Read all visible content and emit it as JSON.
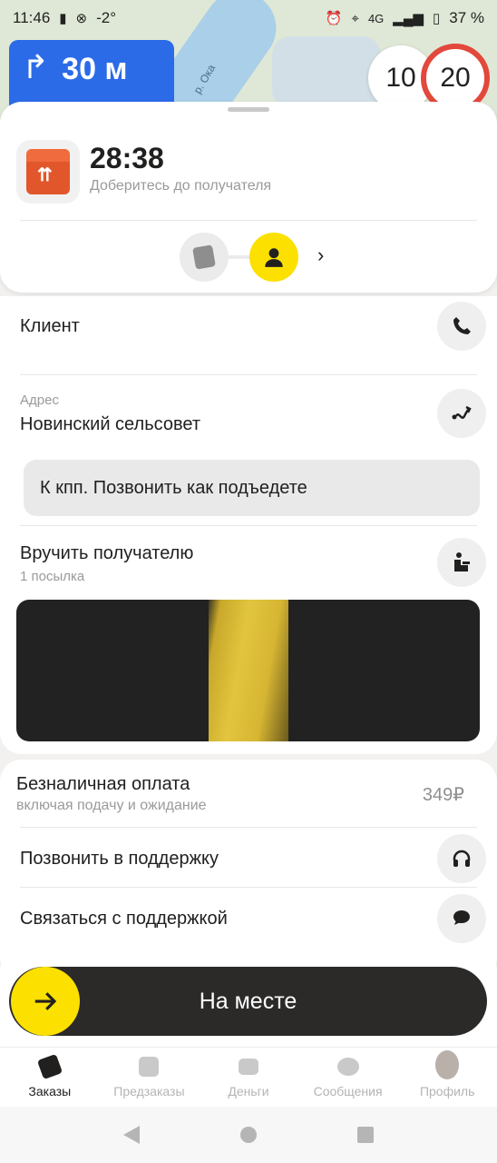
{
  "status_bar": {
    "time": "11:46",
    "temp": "-2°",
    "network": "4G",
    "battery": "37 %"
  },
  "map": {
    "river_label": "р. Ока"
  },
  "navigation": {
    "distance": "30 м",
    "speed_current": "10",
    "speed_limit": "20"
  },
  "order": {
    "eta": "28:38",
    "eta_subtitle": "Доберитесь до получателя"
  },
  "client": {
    "label": "Клиент",
    "address_label": "Адрес",
    "address_value": "Новинский сельсовет",
    "comment": "К кпп. Позвонить как подъедете",
    "handover_label": "Вручить получателю",
    "handover_sub": "1 посылка"
  },
  "payment": {
    "label": "Безналичная оплата",
    "sub": "включая подачу и ожидание",
    "price": "349₽",
    "call_support": "Позвонить в поддержку",
    "contact_support": "Связаться с поддержкой"
  },
  "action": {
    "label": "На месте"
  },
  "tabs": [
    {
      "label": "Заказы",
      "icon": "box-icon",
      "active": true
    },
    {
      "label": "Предзаказы",
      "icon": "calendar-icon",
      "active": false
    },
    {
      "label": "Деньги",
      "icon": "wallet-icon",
      "active": false
    },
    {
      "label": "Сообщения",
      "icon": "chat-icon",
      "active": false
    },
    {
      "label": "Профиль",
      "icon": "avatar-icon",
      "active": false
    }
  ],
  "colors": {
    "accent_yellow": "#fce000",
    "nav_blue": "#2c6be8",
    "box_orange": "#e2562c",
    "speed_red": "#e2483b"
  }
}
